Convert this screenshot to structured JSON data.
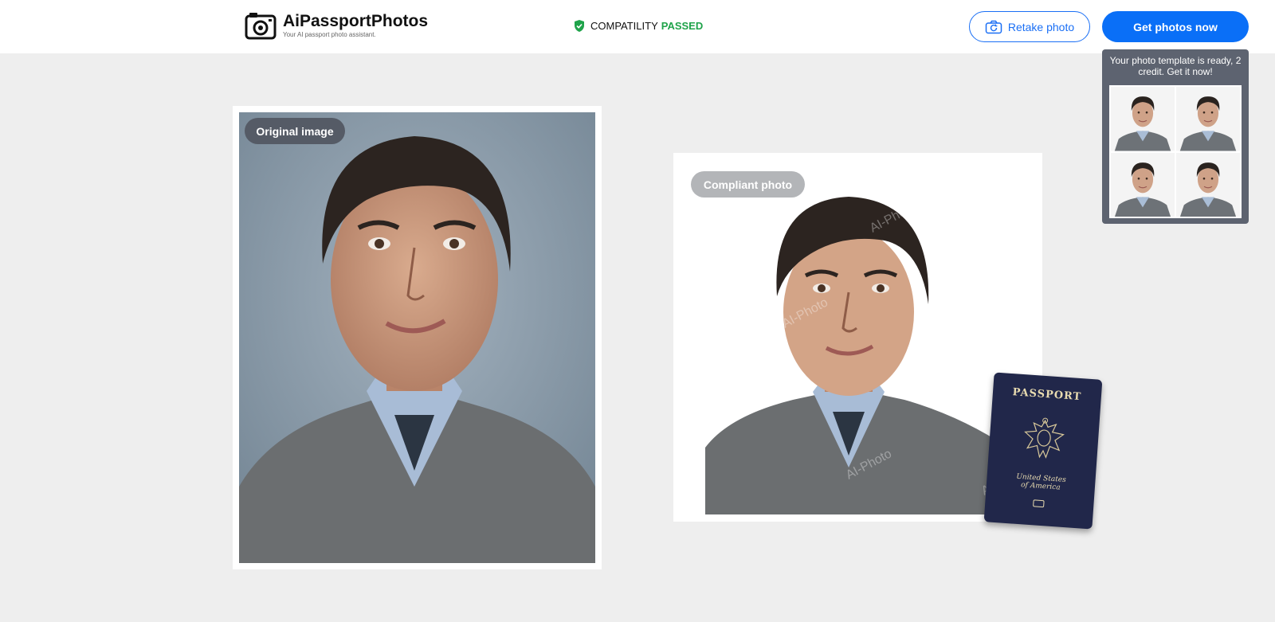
{
  "header": {
    "brand": "AiPassportPhotos",
    "tagline": "Your AI passport photo assistant.",
    "compat_label": "COMPATILITY",
    "compat_status": "PASSED",
    "retake_label": "Retake photo",
    "get_label": "Get photos now"
  },
  "popup": {
    "message": "Your photo template is ready, 2 credit. Get it now!"
  },
  "original": {
    "label": "Original image"
  },
  "compliant": {
    "label": "Compliant photo",
    "watermark": "AI-Photo"
  },
  "passport": {
    "title": "PASSPORT",
    "country_line1": "United States",
    "country_line2": "of America"
  },
  "colors": {
    "accent": "#0a6ff7",
    "passed": "#1fa34a",
    "popup_bg": "#5d6370",
    "page_bg": "#eeeeee"
  }
}
